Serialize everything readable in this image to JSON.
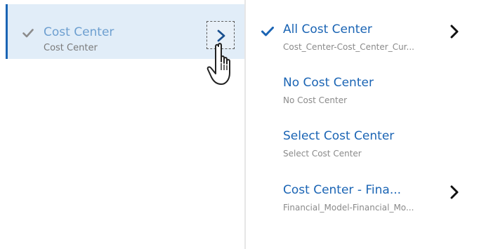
{
  "left_list": {
    "items": [
      {
        "label": "Cost Center",
        "sublabel": "Cost Center",
        "checked": true,
        "check_icon": "checkmark-icon",
        "expand_icon": "chevron-right-icon"
      }
    ]
  },
  "cursor": {
    "icon": "hand-pointer-icon"
  },
  "right_list": {
    "items": [
      {
        "label": "All Cost Center",
        "sublabel": "Cost_Center-Cost_Center_Cur...",
        "checked": true,
        "has_children": true
      },
      {
        "label": "No Cost Center",
        "sublabel": "No Cost Center",
        "checked": false,
        "has_children": false
      },
      {
        "label": "Select Cost Center",
        "sublabel": "Select Cost Center",
        "checked": false,
        "has_children": false
      },
      {
        "label": "Cost Center - Fina...",
        "sublabel": "Financial_Model-Financial_Mo...",
        "checked": false,
        "has_children": true
      }
    ]
  },
  "colors": {
    "accent": "#1a64b4",
    "selected_bg": "#e1edf8",
    "muted_title": "#6d9fd0",
    "subtext": "#8a8a8a"
  }
}
